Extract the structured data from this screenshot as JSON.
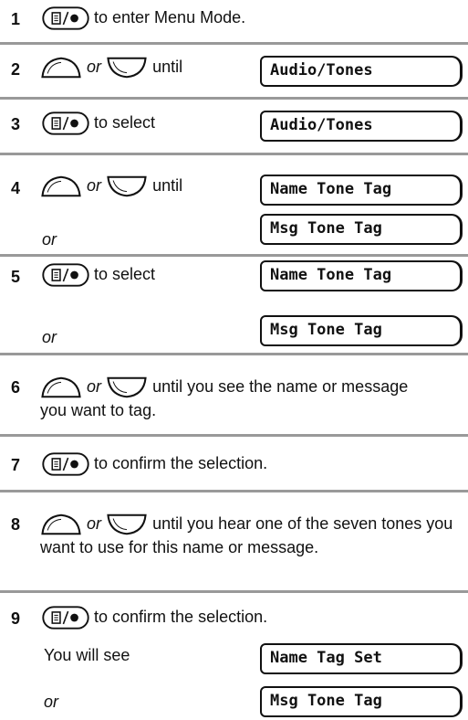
{
  "or_word": "or",
  "steps": [
    {
      "num": "1",
      "text": "to enter Menu Mode."
    },
    {
      "num": "2",
      "text": "until",
      "display": "Audio/Tones"
    },
    {
      "num": "3",
      "text": "to select",
      "display": "Audio/Tones"
    },
    {
      "num": "4",
      "text": "until",
      "display": "Name Tone Tag",
      "or_display": "Msg Tone Tag"
    },
    {
      "num": "5",
      "text": "to select",
      "display": "Name Tone Tag",
      "or_display": "Msg Tone Tag"
    },
    {
      "num": "6",
      "text": "until you see the name or message you want to tag."
    },
    {
      "num": "7",
      "text": "to confirm the selection."
    },
    {
      "num": "8",
      "text": "until you hear one of the seven tones you want to use for this name or message."
    },
    {
      "num": "9",
      "text": "to confirm the selection.",
      "note": "You will see",
      "display": "Name Tag Set",
      "or_display": "Msg Tone Tag"
    }
  ],
  "icons": {
    "menu_key": "menu-select-key-icon",
    "scroll_up": "scroll-up-key-icon",
    "scroll_down": "scroll-down-key-icon"
  }
}
